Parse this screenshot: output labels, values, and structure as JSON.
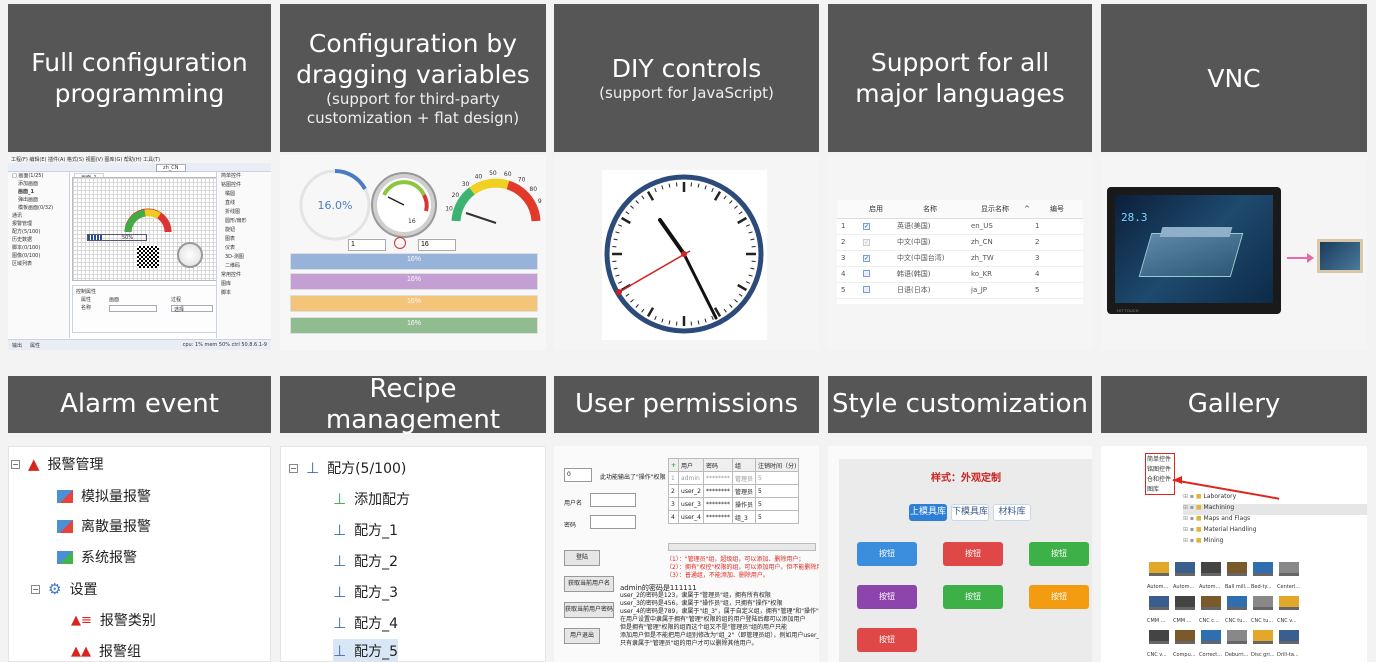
{
  "banners": [
    {
      "title": "Full configuration programming",
      "sub": ""
    },
    {
      "title": "Configuration by dragging variables",
      "sub": "(support for third-party customization + flat design)"
    },
    {
      "title": "DIY controls",
      "sub": "(support for JavaScript)"
    },
    {
      "title": "Support for all major languages",
      "sub": ""
    },
    {
      "title": "VNC",
      "sub": ""
    },
    {
      "title": "Alarm event",
      "sub": ""
    },
    {
      "title": "Recipe management",
      "sub": ""
    },
    {
      "title": "User permissions",
      "sub": ""
    },
    {
      "title": "Style customization",
      "sub": ""
    },
    {
      "title": "Gallery",
      "sub": ""
    }
  ],
  "ide": {
    "menu": "工程(F) 编辑(E) 插件(A) 格式(S) 视图(V) 图库(G) 帮助(H) 工具(T)",
    "lang_select": "zh_CN",
    "tab": "画面_1",
    "tree": [
      "□ 画面(1/25)",
      "添加画面",
      "画面_1",
      "弹出画面",
      "模板画面(0/32)",
      "通讯",
      "报警管理",
      "配方(5/100)",
      "历史数据",
      "脚本(0/100)",
      "图像(0/100)",
      "区域列表"
    ],
    "right_items": [
      "简单控件",
      "铭图控件",
      "橘圆",
      "直线",
      "折线图",
      "圆形/扇形",
      "旋钮",
      "图表",
      "仪表",
      "3D-测图",
      "二维码",
      "常用控件",
      "图库",
      "脚本"
    ],
    "bottom_labels": [
      "控制属性",
      "属性",
      "名称",
      "画面",
      "过程",
      "选择"
    ],
    "value_percent": "50%",
    "status": "cpu: 1% mem 50% ctrl 50.8.6.1-9",
    "status_left": [
      "输出",
      "属性"
    ]
  },
  "progress": {
    "ring_value": "16.0%",
    "gauge_ticks": [
      "10",
      "20",
      "30",
      "40",
      "50",
      "60",
      "70",
      "80",
      "90",
      "100"
    ],
    "gauge_value": "16",
    "input_a": "1",
    "input_b": "16",
    "bars": [
      {
        "label": "16%",
        "color": "#4a7cc1",
        "pct": 16
      },
      {
        "label": "16%",
        "color": "#9b59b6",
        "pct": 16
      },
      {
        "label": "16%",
        "color": "#f39c12",
        "pct": 16
      },
      {
        "label": "16%",
        "color": "#3c8c3c",
        "pct": 16
      }
    ]
  },
  "languages": {
    "headers": [
      "启用",
      "名称",
      "显示名称",
      "编号"
    ],
    "rows": [
      {
        "n": "1",
        "name": "英语(美国)",
        "code": "en_US",
        "id": "1"
      },
      {
        "n": "2",
        "name": "中文(中国)",
        "code": "zh_CN",
        "id": "2"
      },
      {
        "n": "3",
        "name": "中文(中国台湾)",
        "code": "zh_TW",
        "id": "3"
      },
      {
        "n": "4",
        "name": "韩语(韩国)",
        "code": "ko_KR",
        "id": "4"
      },
      {
        "n": "5",
        "name": "日语(日本)",
        "code": "ja_JP",
        "id": "5"
      }
    ]
  },
  "vnc": {
    "temp": "28.3",
    "brand": "HIT TOUCH"
  },
  "alarm": {
    "root": "报警管理",
    "items": [
      "模拟量报警",
      "离散量报警",
      "系统报警"
    ],
    "settings": "设置",
    "sub": [
      "报警类别",
      "报警组"
    ]
  },
  "recipe": {
    "root": "配方(5/100)",
    "add": "添加配方",
    "items": [
      "配方_1",
      "配方_2",
      "配方_3",
      "配方_4",
      "配方_5"
    ]
  },
  "users": {
    "top_input": "0",
    "top_label": "此功能输出了\"操作\"权限",
    "user_label": "用户名",
    "pass_label": "密码",
    "login": "登陆",
    "btn_current": "获取当前用户名",
    "btn_all": "获取当前用户密码",
    "btn_logout": "用户退出",
    "table_headers": [
      "+",
      "用户",
      "密码",
      "组",
      "注销时间（分)"
    ],
    "table_rows": [
      [
        "1",
        "admin",
        "********",
        "管理员",
        "5"
      ],
      [
        "2",
        "user_2",
        "********",
        "管理员",
        "5"
      ],
      [
        "3",
        "user_3",
        "********",
        "操作员",
        "5"
      ],
      [
        "4",
        "user_4",
        "********",
        "组_3",
        "5"
      ]
    ],
    "notes": [
      "（1）：\"管理员\"组，超级组，可以添加、删除用户；",
      "（2）：拥有\"权控\"权限的组，可以添加用户，但不能删除用户；",
      "（3）：普通组，不能添加、删除用户。"
    ],
    "desc": [
      "admin的密码是111111",
      "user_2的密码是123，隶属于\"管理员\"组，拥有所有权限",
      "user_3的密码是456，隶属于\"操作员\"组，只拥有\"操作\"权限",
      "user_4的密码是789，隶属于\"组_3\"，属于自定义组，拥有\"管理\"和\"操作\"权限",
      "在用户设置中隶属于拥有\"管理\"权限的组的用户登陆后都可以添加用户",
      "但是拥有\"管理\"权限的组而这个组又不是\"管理员\"组的用户只能",
      "添加用户但是不能把用户组别修改为\"组_2\"（即管理员组），例如用户user_4；",
      "只有隶属于\"管理员\"组的用户才可以删除其他用户。"
    ]
  },
  "style": {
    "title": "样式：外观定制",
    "tabs": [
      "上模具库",
      "下模具库",
      "材料库"
    ],
    "buttons": [
      {
        "label": "按钮",
        "color": "#3b8ede"
      },
      {
        "label": "按钮",
        "color": "#e04848"
      },
      {
        "label": "按钮",
        "color": "#3db047"
      },
      {
        "label": "按钮",
        "color": "#8e44ad"
      },
      {
        "label": "按钮",
        "color": "#3db047"
      },
      {
        "label": "按钮",
        "color": "#f39c12"
      },
      {
        "label": "按钮",
        "color": "#e04848"
      }
    ]
  },
  "gallery": {
    "top": [
      "简单控件",
      "铭图控件",
      "仓和控件",
      "图库"
    ],
    "nodes": [
      "Laboratory",
      "Machining",
      "Maps and Flags",
      "Material Handling",
      "Mining"
    ],
    "row1": [
      "Autom...",
      "Autom...",
      "Autom...",
      "Ball mill...",
      "Bed-ty...",
      "Centerl..."
    ],
    "row2": [
      "CMM ...",
      "CMM ...",
      "CNC c...",
      "CNC tu...",
      "CNC tu...",
      "CNC v..."
    ],
    "row3": [
      "CNC v...",
      "Compu...",
      "Correct...",
      "Deburri...",
      "Disc gri...",
      "Drill-ta..."
    ]
  }
}
